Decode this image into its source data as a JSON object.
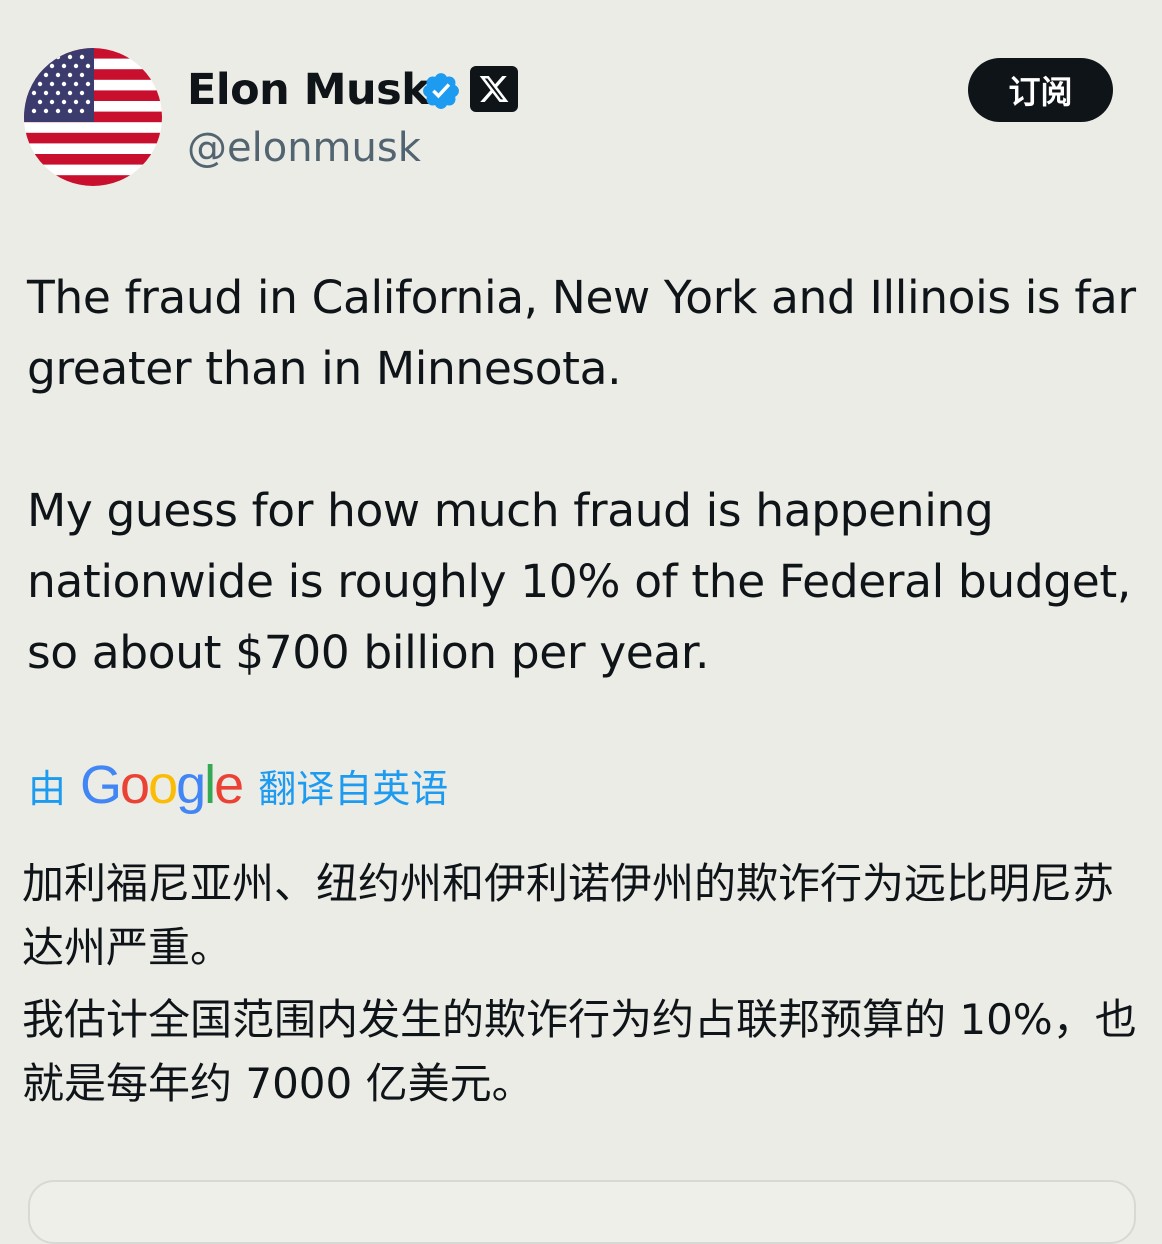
{
  "author": {
    "name": "Elon Musk",
    "handle": "@elonmusk",
    "avatar_icon": "us-flag-avatar",
    "verified_color": "#1d9bf0",
    "affiliate_badge": "X"
  },
  "subscribe_button": {
    "label": "订阅"
  },
  "tweet": {
    "paragraphs": [
      "The fraud in California, New York and Illinois is far greater than in Minnesota.",
      "My guess for how much fraud is happening nationwide is roughly 10% of the Federal budget, so about $700 billion per year."
    ]
  },
  "translation": {
    "by_label": "由",
    "provider": "Google",
    "from_label": "翻译自英语",
    "paragraphs": [
      "加利福尼亚州、纽约州和伊利诺伊州的欺诈行为远比明尼苏达州严重。",
      "我估计全国范围内发生的欺诈行为约占联邦预算的 10%，也就是每年约 7000 亿美元。"
    ]
  },
  "colors": {
    "background": "#ecece6",
    "text": "#0f1419",
    "secondary": "#536471",
    "link": "#1d9bf0"
  }
}
